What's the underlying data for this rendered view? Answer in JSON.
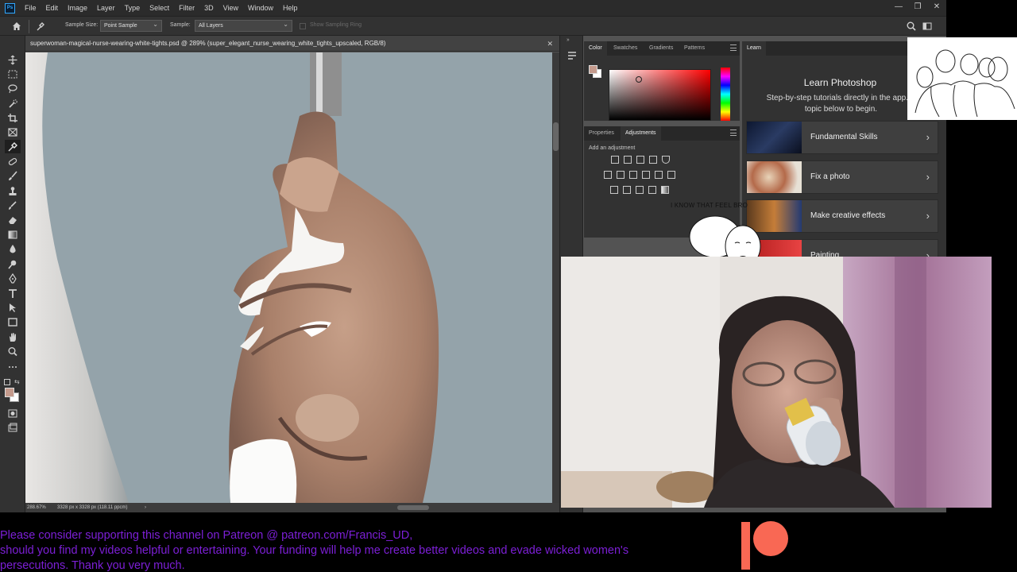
{
  "menu": {
    "items": [
      "File",
      "Edit",
      "Image",
      "Layer",
      "Type",
      "Select",
      "Filter",
      "3D",
      "View",
      "Window",
      "Help"
    ]
  },
  "window_controls": {
    "minimize": "—",
    "restore": "❐",
    "close": "✕"
  },
  "options": {
    "sample_size_label": "Sample Size:",
    "sample_size_value": "Point Sample",
    "sample_label": "Sample:",
    "sample_value": "All Layers",
    "show_ring_label": "Show Sampling Ring"
  },
  "document": {
    "tab_title": "superwoman-magical-nurse-wearing-white-tights.psd @ 289% (super_elegant_nurse_wearing_white_tights_upscaled, RGB/8)",
    "close": "✕",
    "zoom": "288.67%",
    "dimensions": "3328 px x 3328 px (118.11 ppcm)",
    "status_arrow": "›"
  },
  "color_panel": {
    "tabs": [
      "Color",
      "Swatches",
      "Gradients",
      "Patterns"
    ],
    "active_tab": "Color",
    "foreground_color": "#c49a8c",
    "background_color": "#ffffff"
  },
  "adjustments_panel": {
    "tabs": [
      "Properties",
      "Adjustments"
    ],
    "active_tab": "Adjustments",
    "add_label": "Add an adjustment",
    "icons": [
      "brightness-contrast-icon",
      "levels-icon",
      "curves-icon",
      "exposure-icon",
      "vibrance-icon",
      "hue-saturation-icon",
      "color-balance-icon",
      "black-white-icon",
      "photo-filter-icon",
      "channel-mixer-icon",
      "color-lookup-icon",
      "invert-icon",
      "posterize-icon",
      "threshold-icon",
      "selective-color-icon",
      "gradient-map-icon"
    ]
  },
  "learn_panel": {
    "tab": "Learn",
    "title": "Learn Photoshop",
    "subtitle_line1": "Step-by-step tutorials directly in the app. P",
    "subtitle_line2": "topic below to begin.",
    "cards": [
      {
        "label": "Fundamental Skills",
        "chevron": "›"
      },
      {
        "label": "Fix a photo",
        "chevron": "›"
      },
      {
        "label": "Make creative effects",
        "chevron": "›"
      },
      {
        "label": "Painting",
        "chevron": "›"
      }
    ]
  },
  "meme": {
    "text": "I KNOW THAT FEEL BRO"
  },
  "footer": {
    "line1": "Please consider supporting this channel on Patreon @ patreon.com/Francis_UD,",
    "line2": "should you find my videos helpful or entertaining. Your funding will help me create better videos and evade wicked women's",
    "line3": "persecutions.  Thank you very much.",
    "color": "#7c1fd6"
  },
  "patreon": {
    "color": "#f96854",
    "icon": "patreon-logo"
  }
}
